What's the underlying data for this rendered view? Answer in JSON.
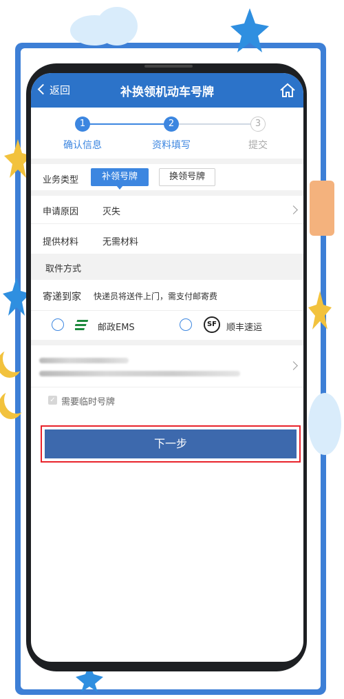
{
  "header": {
    "back_label": "返回",
    "title": "补换领机动车号牌"
  },
  "steps": [
    {
      "num": "1",
      "label": "确认信息"
    },
    {
      "num": "2",
      "label": "资料填写"
    },
    {
      "num": "3",
      "label": "提交"
    }
  ],
  "business": {
    "label": "业务类型",
    "options": [
      "补领号牌",
      "换领号牌"
    ]
  },
  "reason": {
    "label": "申请原因",
    "value": "灭失"
  },
  "materials": {
    "label": "提供材料",
    "value": "无需材料"
  },
  "pickup": {
    "section_title": "取件方式"
  },
  "delivery": {
    "label": "寄递到家",
    "description": "快递员将送件上门，需支付邮寄费",
    "options": [
      {
        "name": "邮政EMS",
        "icon": "ems-logo-icon"
      },
      {
        "name": "顺丰速运",
        "icon": "sf-logo-icon"
      }
    ]
  },
  "temp_plate": {
    "label": "需要临时号牌"
  },
  "next_button": {
    "label": "下一步"
  },
  "colors": {
    "primary": "#2c73c9",
    "button": "#3d69ad",
    "highlight_border": "#e8222a"
  }
}
